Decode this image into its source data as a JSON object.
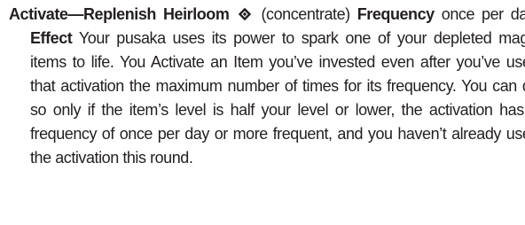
{
  "ability": {
    "name": "Activate—Replenish Heirloom",
    "action_icon": "single-action-icon",
    "traits": "(concentrate)",
    "frequency_label": "Frequency",
    "frequency_value": "once per day;",
    "effect_label": "Effect",
    "effect_text": "Your pusaka uses its power to spark one of your depleted magic items to life. You Activate an Item you’ve invested even after you’ve used that activation the maximum number of times for its frequency. You can do so only if the item’s level is half your level or lower, the activation has a frequency of once per day or more frequent, and you haven’t already used the activation this round."
  }
}
